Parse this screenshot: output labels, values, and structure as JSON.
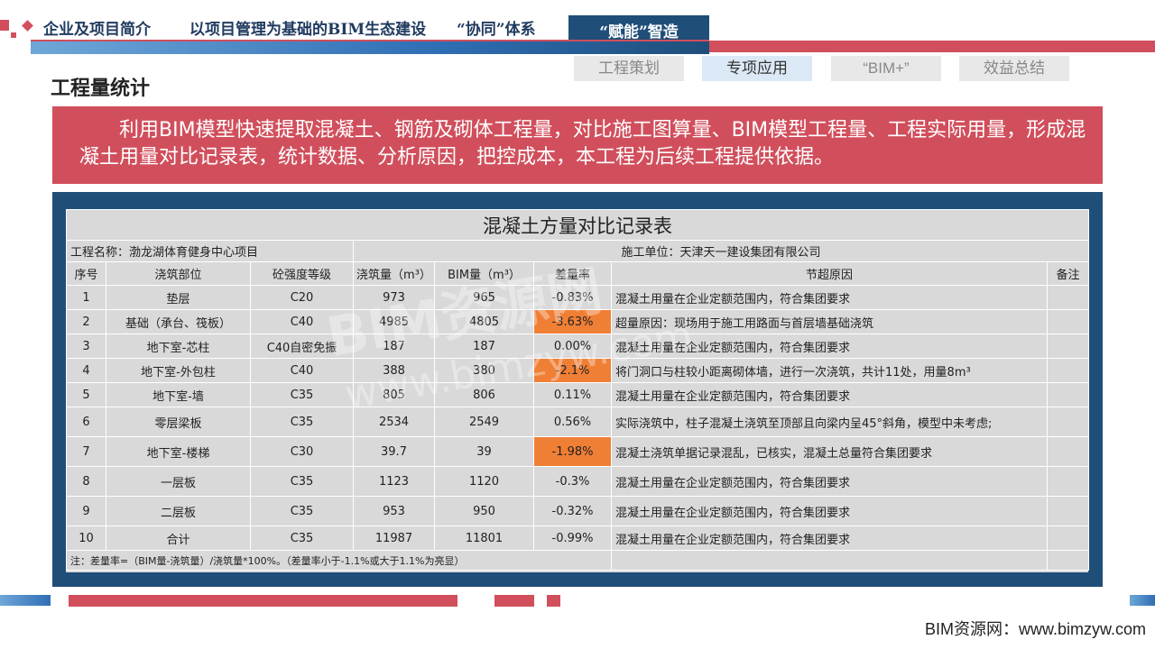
{
  "nav": {
    "items": [
      "企业及项目简介",
      "以项目管理为基础的BIM生态建设",
      "“协同”体系",
      "“赋能”智造"
    ]
  },
  "subtabs": [
    "工程策划",
    "专项应用",
    "“BIM+”",
    "效益总结"
  ],
  "page_title": "工程量统计",
  "summary": "利用BIM模型快速提取混凝土、钢筋及砌体工程量，对比施工图算量、BIM模型工程量、工程实际用量，形成混凝土用量对比记录表，统计数据、分析原因，把控成本，本工程为后续工程提供依据。",
  "table": {
    "title": "混凝土方量对比记录表",
    "project_label": "工程名称：渤龙湖体育健身中心项目",
    "unit_label": "施工单位：天津天一建设集团有限公司",
    "headers": [
      "序号",
      "浇筑部位",
      "砼强度等级",
      "浇筑量（m³）",
      "BIM量（m³）",
      "差量率",
      "节超原因",
      "备注"
    ],
    "rows": [
      {
        "no": "1",
        "part": "垫层",
        "grade": "C20",
        "poured": "973",
        "bim": "965",
        "rate": "-0.83%",
        "reason": "混凝土用量在企业定额范围内，符合集团要求",
        "note": ""
      },
      {
        "no": "2",
        "part": "基础（承台、筏板）",
        "grade": "C40",
        "poured": "4985",
        "bim": "4805",
        "rate": "-3.63%",
        "reason": "超量原因：现场用于施工用路面与首层墙基础浇筑",
        "note": ""
      },
      {
        "no": "3",
        "part": "地下室-芯柱",
        "grade": "C40自密免振",
        "poured": "187",
        "bim": "187",
        "rate": "0.00%",
        "reason": "混凝土用量在企业定额范围内，符合集团要求",
        "note": ""
      },
      {
        "no": "4",
        "part": "地下室-外包柱",
        "grade": "C40",
        "poured": "388",
        "bim": "380",
        "rate": "-2.1%",
        "reason": "将门洞口与柱较小距离砌体墙，进行一次浇筑，共计11处，用量8m³",
        "note": ""
      },
      {
        "no": "5",
        "part": "地下室-墙",
        "grade": "C35",
        "poured": "805",
        "bim": "806",
        "rate": "0.11%",
        "reason": "混凝土用量在企业定额范围内，符合集团要求",
        "note": ""
      },
      {
        "no": "6",
        "part": "零层梁板",
        "grade": "C35",
        "poured": "2534",
        "bim": "2549",
        "rate": "0.56%",
        "reason": "实际浇筑中，柱子混凝土浇筑至顶部且向梁内呈45°斜角，模型中未考虑;",
        "note": ""
      },
      {
        "no": "7",
        "part": "地下室-楼梯",
        "grade": "C30",
        "poured": "39.7",
        "bim": "39",
        "rate": "-1.98%",
        "reason": "混凝土浇筑单据记录混乱，已核实，混凝土总量符合集团要求",
        "note": ""
      },
      {
        "no": "8",
        "part": "一层板",
        "grade": "C35",
        "poured": "1123",
        "bim": "1120",
        "rate": "-0.3%",
        "reason": "混凝土用量在企业定额范围内，符合集团要求",
        "note": ""
      },
      {
        "no": "9",
        "part": "二层板",
        "grade": "C35",
        "poured": "953",
        "bim": "950",
        "rate": "-0.32%",
        "reason": "混凝土用量在企业定额范围内，符合集团要求",
        "note": ""
      },
      {
        "no": "10",
        "part": "合计",
        "grade": "C35",
        "poured": "11987",
        "bim": "11801",
        "rate": "-0.99%",
        "reason": "混凝土用量在企业定额范围内，符合集团要求",
        "note": ""
      }
    ],
    "footnote": "注：差量率=（BIM量-浇筑量）/浇筑量*100%。（差量率小于-1.1%或大于1.1%为亮显）",
    "highlight_color": "#f07f36"
  },
  "watermark": "BIM资源网",
  "watermark_url": "www.bimzyw.com",
  "footer": "BIM资源网：www.bimzyw.com",
  "colors": {
    "accent_red": "#d14f5c",
    "navy": "#1f4e79"
  }
}
